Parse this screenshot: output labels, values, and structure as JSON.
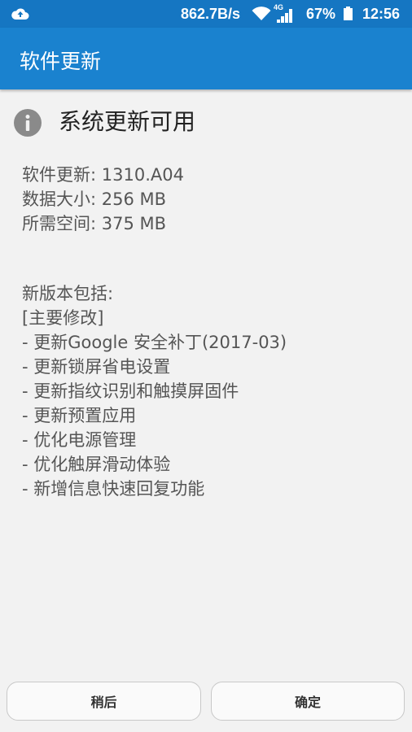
{
  "status_bar": {
    "net_speed": "862.7B/s",
    "network_type": "4G",
    "battery_percent": "67%",
    "time": "12:56",
    "icons": [
      "cloud-upload-icon",
      "wifi-icon",
      "signal-icon",
      "battery-icon"
    ]
  },
  "app_bar": {
    "title": "软件更新"
  },
  "update": {
    "heading": "系统更新可用",
    "info": [
      "软件更新: 1310.A04",
      "数据大小: 256 MB",
      "所需空间: 375 MB"
    ],
    "notes": [
      "新版本包括:",
      "[主要修改]",
      "- 更新Google 安全补丁(2017-03)",
      "- 更新锁屏省电设置",
      "- 更新指纹识别和触摸屏固件",
      "- 更新预置应用",
      "- 优化电源管理",
      "- 优化触屏滑动体验",
      "- 新增信息快速回复功能"
    ]
  },
  "buttons": {
    "later": "稍后",
    "ok": "确定"
  },
  "colors": {
    "status_bar": "#1576c2",
    "app_bar": "#1a82cf",
    "background": "#f2f2f2"
  }
}
